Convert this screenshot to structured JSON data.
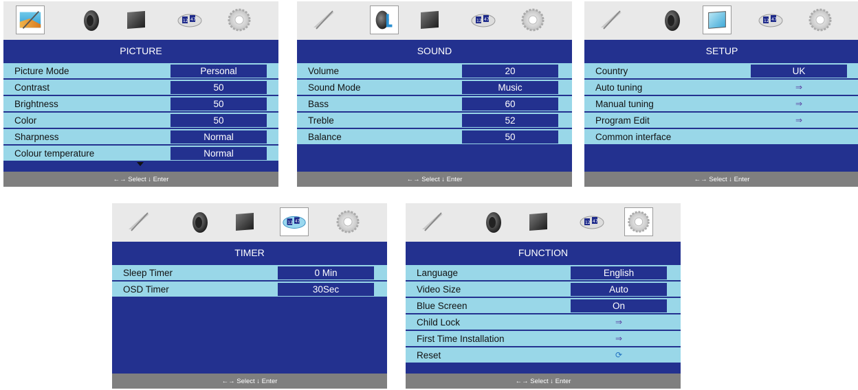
{
  "footer": {
    "hint": "←→ Select   ↓ Enter"
  },
  "icons": [
    "picture-icon",
    "speaker-icon",
    "monitor-icon",
    "timer-icon",
    "gear-icon"
  ],
  "menus": {
    "picture": {
      "title": "PICTURE",
      "rows": [
        {
          "label": "Picture Mode",
          "value": "Personal"
        },
        {
          "label": "Contrast",
          "value": "50"
        },
        {
          "label": "Brightness",
          "value": "50"
        },
        {
          "label": "Color",
          "value": "50"
        },
        {
          "label": "Sharpness",
          "value": "Normal"
        },
        {
          "label": "Colour temperature",
          "value": "Normal"
        }
      ]
    },
    "sound": {
      "title": "SOUND",
      "rows": [
        {
          "label": "Volume",
          "value": "20"
        },
        {
          "label": "Sound Mode",
          "value": "Music"
        },
        {
          "label": "Bass",
          "value": "60"
        },
        {
          "label": "Treble",
          "value": "52"
        },
        {
          "label": "Balance",
          "value": "50"
        }
      ]
    },
    "setup": {
      "title": "SETUP",
      "rows": [
        {
          "label": "Country",
          "value": "UK"
        },
        {
          "label": "Auto tuning",
          "value": "⇒"
        },
        {
          "label": "Manual tuning",
          "value": "⇒"
        },
        {
          "label": "Program Edit",
          "value": "⇒"
        },
        {
          "label": "Common interface",
          "value": ""
        }
      ]
    },
    "timer": {
      "title": "TIMER",
      "rows": [
        {
          "label": "Sleep Timer",
          "value": "0 Min"
        },
        {
          "label": "OSD Timer",
          "value": "30Sec"
        }
      ]
    },
    "function": {
      "title": "FUNCTION",
      "rows": [
        {
          "label": "Language",
          "value": "English"
        },
        {
          "label": "Video Size",
          "value": "Auto"
        },
        {
          "label": "Blue Screen",
          "value": "On"
        },
        {
          "label": "Child Lock",
          "value": "⇒"
        },
        {
          "label": "First Time Installation",
          "value": "⇒"
        },
        {
          "label": "Reset",
          "value": "⟳"
        }
      ]
    }
  }
}
